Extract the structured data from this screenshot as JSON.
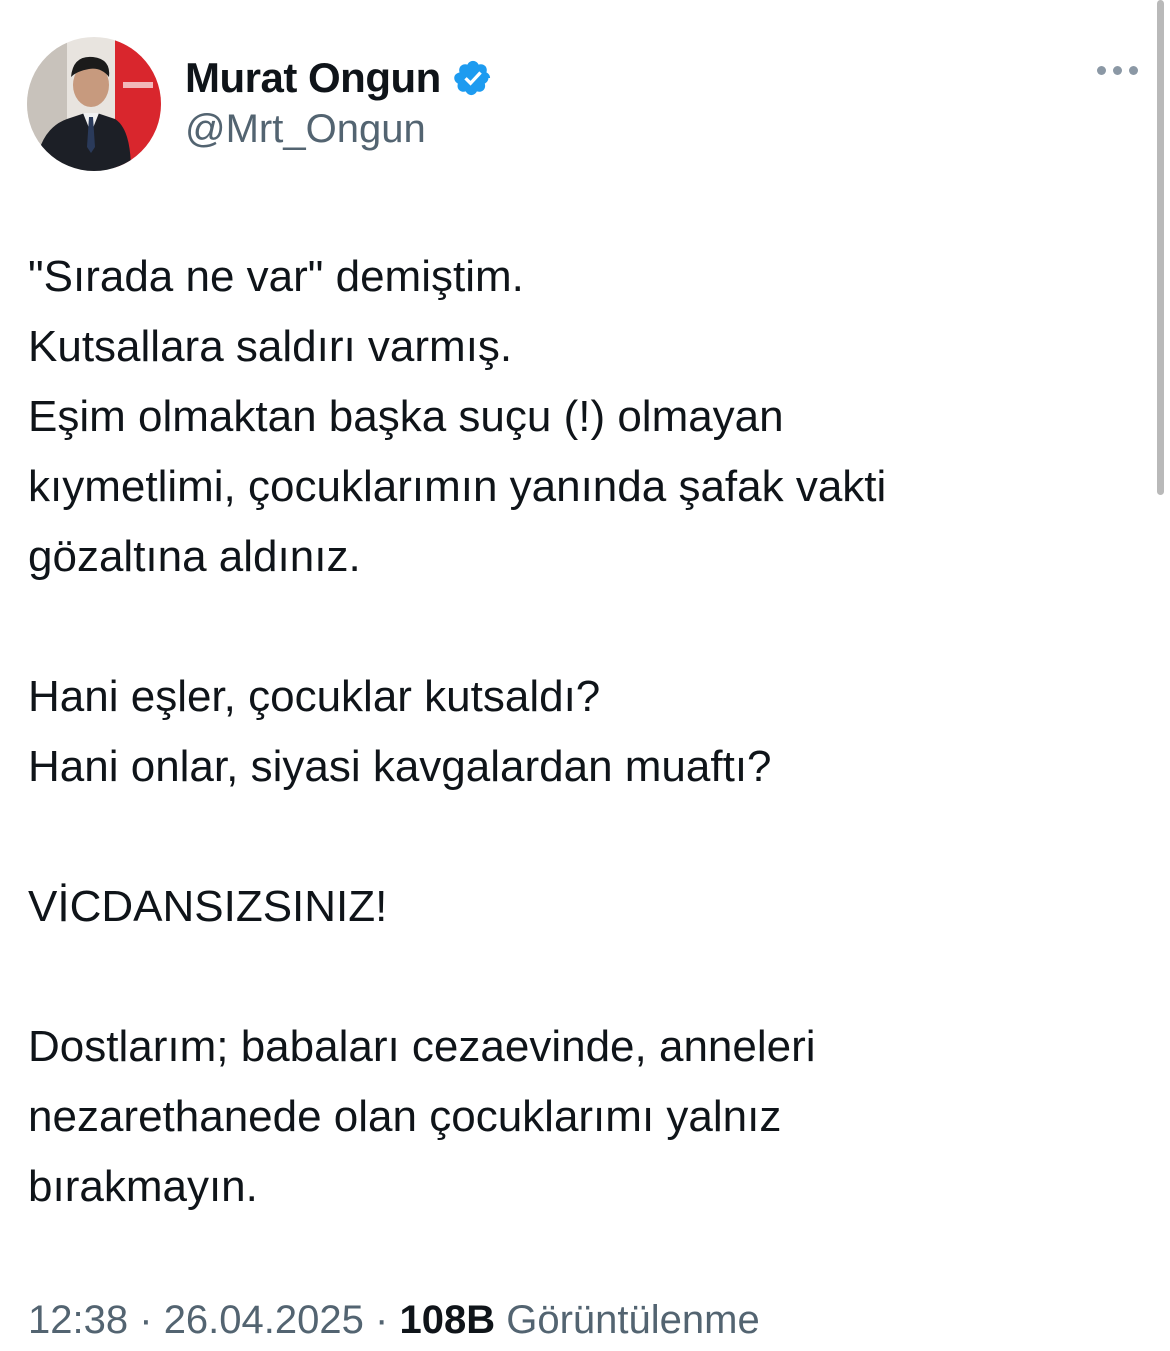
{
  "author": {
    "name": "Murat Ongun",
    "handle": "@Mrt_Ongun",
    "verified_color": "#1d9bf0"
  },
  "tweet": {
    "lines": [
      "\"Sırada ne var\" demiştim.",
      "Kutsallara saldırı varmış.",
      "Eşim olmaktan başka suçu (!) olmayan",
      "kıymetlimi, çocuklarımın yanında şafak vakti",
      "gözaltına aldınız.",
      "",
      "Hani eşler, çocuklar kutsaldı?",
      "Hani onlar, siyasi kavgalardan muaftı?",
      "",
      "VİCDANSIZSINIZ!",
      "",
      "Dostlarım; babaları cezaevinde, anneleri",
      "nezarethanede olan çocuklarımı yalnız",
      "bırakmayın."
    ]
  },
  "meta": {
    "time": "12:38",
    "separator": "·",
    "date": "26.04.2025",
    "views_count": "108B",
    "views_label": "Görüntülenme"
  },
  "icons": {
    "more": "more-horizontal-icon",
    "verified": "verified-badge-icon"
  }
}
